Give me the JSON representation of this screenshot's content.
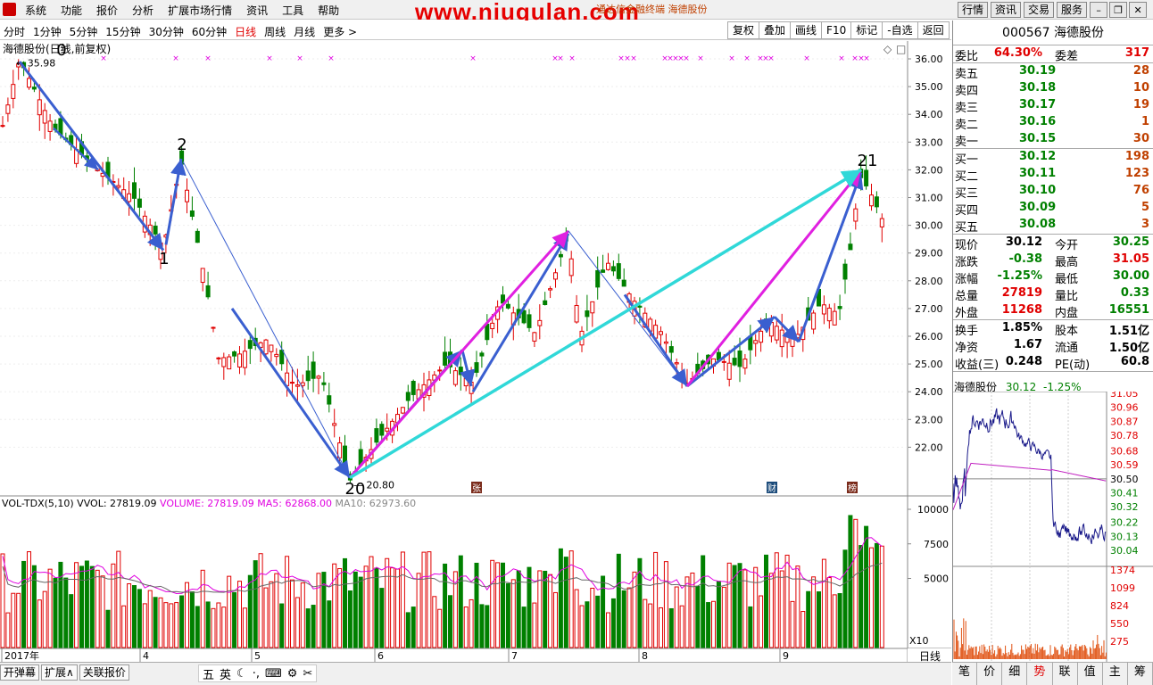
{
  "menu": {
    "items": [
      "系统",
      "功能",
      "报价",
      "分析",
      "扩展市场行情",
      "资讯",
      "工具",
      "帮助"
    ]
  },
  "watermark": "www.niugulan.com",
  "broker": "通达信金融终端  海德股份",
  "right_buttons": [
    "行情",
    "资讯",
    "交易",
    "服务"
  ],
  "periods": {
    "items": [
      "分时",
      "1分钟",
      "5分钟",
      "15分钟",
      "30分钟",
      "60分钟",
      "日线",
      "周线",
      "月线",
      "更多 >"
    ],
    "active": "日线"
  },
  "tools": [
    "复权",
    "叠加",
    "画线",
    "F10",
    "标记",
    "-自选",
    "返回"
  ],
  "chart": {
    "title": "海德股份(日线,前复权)",
    "high_label": "35.98",
    "low_label": "20.80",
    "price_axis": [
      "36.00",
      "35.00",
      "34.00",
      "33.00",
      "32.00",
      "31.00",
      "30.00",
      "29.00",
      "28.00",
      "27.00",
      "26.00",
      "25.00",
      "24.00",
      "23.00",
      "22.00"
    ],
    "wave_labels": [
      "0",
      "1",
      "2",
      "20",
      "21"
    ],
    "event_tags": [
      "张",
      "财",
      "榜"
    ],
    "vol_header": {
      "name": "VOL-TDX(5,10)",
      "vvol": "VVOL: 27819.09",
      "volume": "VOLUME: 27819.09",
      "ma5": "MA5: 62868.00",
      "ma10": "MA10: 62973.60"
    },
    "vol_axis": [
      "10000",
      "7500",
      "5000"
    ],
    "vol_unit": "X10",
    "date_axis": [
      "2017年",
      "4",
      "5",
      "6",
      "7",
      "8",
      "9"
    ],
    "dayline": "日线"
  },
  "quote": {
    "code": "000567",
    "name": "海德股份",
    "weibi_label": "委比",
    "weibi": "64.30%",
    "weicha_label": "委差",
    "weicha": "317",
    "asks": [
      {
        "label": "卖五",
        "price": "30.19",
        "vol": "28"
      },
      {
        "label": "卖四",
        "price": "30.18",
        "vol": "10"
      },
      {
        "label": "卖三",
        "price": "30.17",
        "vol": "19"
      },
      {
        "label": "卖二",
        "price": "30.16",
        "vol": "1"
      },
      {
        "label": "卖一",
        "price": "30.15",
        "vol": "30"
      }
    ],
    "bids": [
      {
        "label": "买一",
        "price": "30.12",
        "vol": "198"
      },
      {
        "label": "买二",
        "price": "30.11",
        "vol": "123"
      },
      {
        "label": "买三",
        "price": "30.10",
        "vol": "76"
      },
      {
        "label": "买四",
        "price": "30.09",
        "vol": "5"
      },
      {
        "label": "买五",
        "price": "30.08",
        "vol": "3"
      }
    ],
    "stats1": [
      {
        "l": "现价",
        "v": "30.12",
        "c": "#000",
        "l2": "今开",
        "v2": "30.25",
        "c2": "#008000"
      },
      {
        "l": "涨跌",
        "v": "-0.38",
        "c": "#008000",
        "l2": "最高",
        "v2": "31.05",
        "c2": "#e00000"
      },
      {
        "l": "涨幅",
        "v": "-1.25%",
        "c": "#008000",
        "l2": "最低",
        "v2": "30.00",
        "c2": "#008000"
      },
      {
        "l": "总量",
        "v": "27819",
        "c": "#e00000",
        "l2": "量比",
        "v2": "0.33",
        "c2": "#008000"
      },
      {
        "l": "外盘",
        "v": "11268",
        "c": "#e00000",
        "l2": "内盘",
        "v2": "16551",
        "c2": "#008000"
      }
    ],
    "stats2": [
      {
        "l": "换手",
        "v": "1.85%",
        "c": "#000",
        "l2": "股本",
        "v2": "1.51亿",
        "c2": "#000"
      },
      {
        "l": "净资",
        "v": "1.67",
        "c": "#000",
        "l2": "流通",
        "v2": "1.50亿",
        "c2": "#000"
      },
      {
        "l": "收益(三)",
        "v": "0.248",
        "c": "#000",
        "l2": "PE(动)",
        "v2": "60.8",
        "c2": "#000"
      }
    ],
    "mini_name": "海德股份",
    "mini_price": "30.12",
    "mini_pct": "-1.25%",
    "mini_price_axis": [
      "31.05",
      "30.96",
      "30.87",
      "30.78",
      "30.68",
      "30.59",
      "30.50",
      "30.41",
      "30.32",
      "30.22",
      "30.13",
      "30.04"
    ],
    "mini_vol_axis": [
      "1374",
      "1099",
      "824",
      "550",
      "275"
    ]
  },
  "bottom": {
    "tabs": [
      "开弹幕",
      "扩展∧",
      "关联报价"
    ],
    "ime": [
      "五",
      "英",
      "☾",
      "·,",
      "⌨",
      "⚙",
      "✂"
    ],
    "right_tabs": [
      "笔",
      "价",
      "细",
      "势",
      "联",
      "值",
      "主",
      "筹"
    ],
    "right_active": "势"
  },
  "colors": {
    "up": "#e00000",
    "down": "#008000",
    "arrow_blue": "#3a5fd0",
    "arrow_magenta": "#e020e0",
    "arrow_cyan": "#30d8d8",
    "star": "#e000e0"
  }
}
